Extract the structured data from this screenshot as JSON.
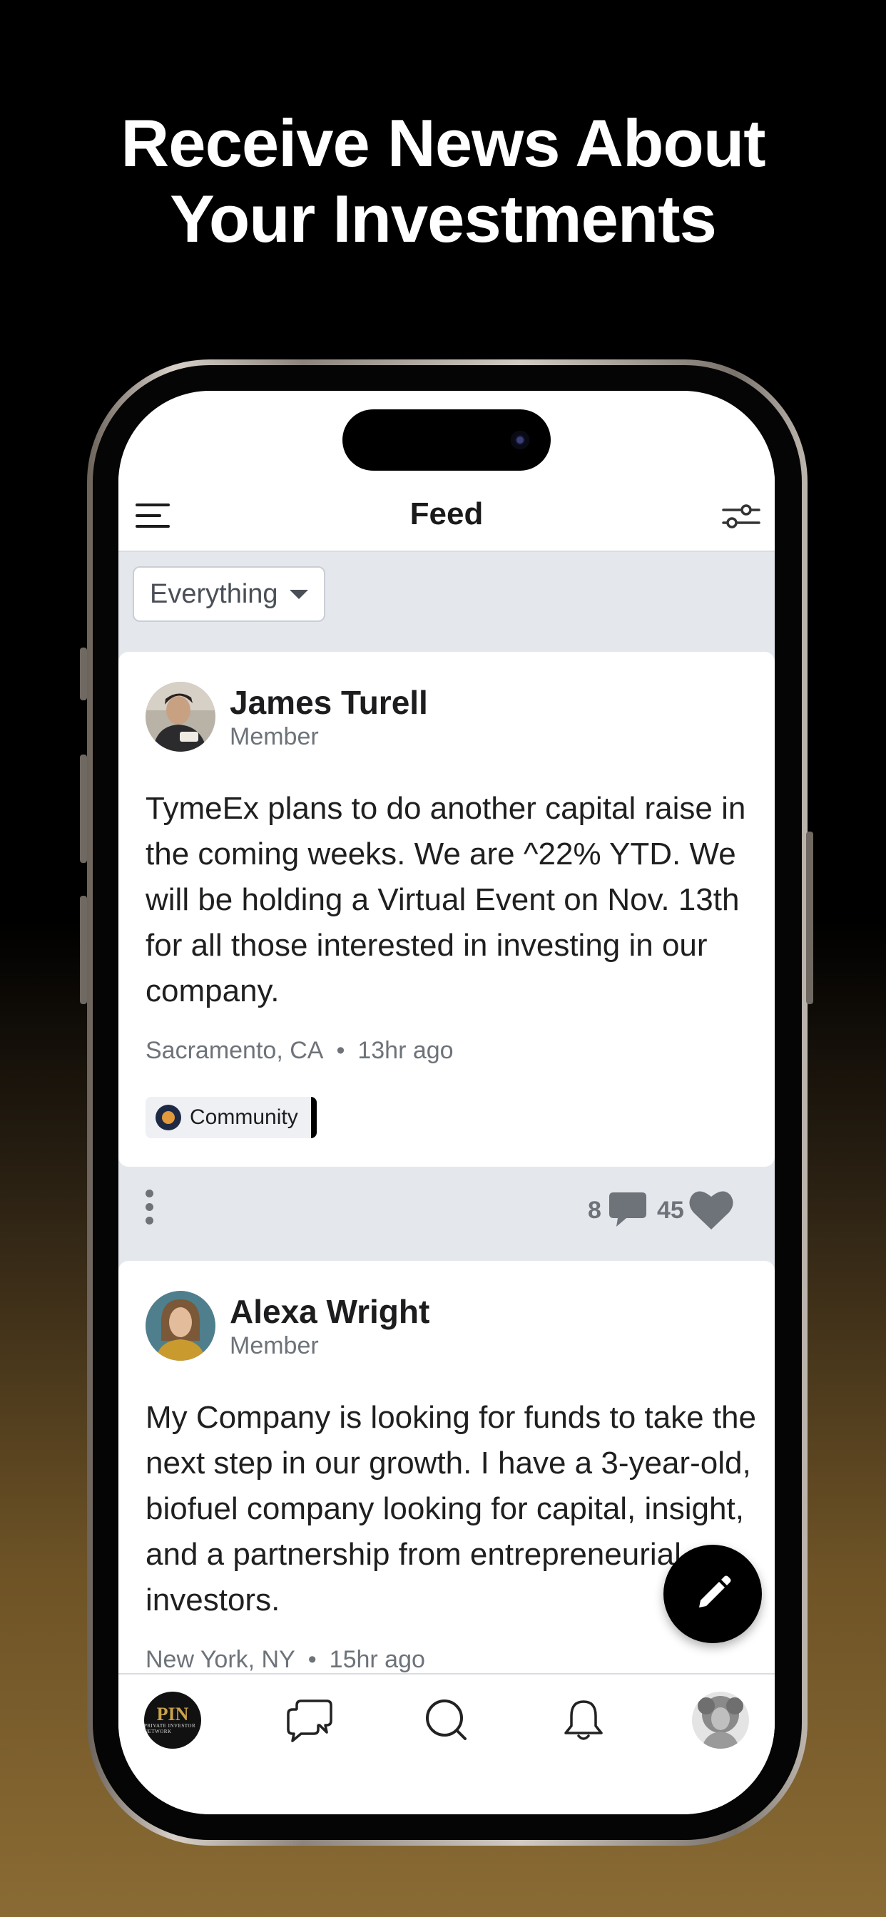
{
  "headline": {
    "line1": "Receive News About",
    "line2": "Your Investments"
  },
  "nav": {
    "title": "Feed",
    "menu_icon": "hamburger-icon",
    "filter_icon": "sliders-icon"
  },
  "filter": {
    "selected": "Everything"
  },
  "posts": [
    {
      "author": "James Turell",
      "role": "Member",
      "body": "TymeEx plans to do another capital raise in the coming weeks. We are ^22% YTD. We will be holding a Virtual Event on Nov. 13th for all those interested in investing in our company.",
      "location": "Sacramento, CA",
      "time": "13hr ago",
      "tag": "Community",
      "comments": "8",
      "likes": "45"
    },
    {
      "author": "Alexa Wright",
      "role": "Member",
      "body": "My Company is looking for funds to take the next step in our growth. I have a 3-year-old, biofuel company looking for capital, insight, and a partnership from entrepreneurial investors.",
      "location": "New York, NY",
      "time": "15hr ago"
    }
  ],
  "tabbar": {
    "logo_text": "PIN",
    "logo_subtext": "PRIVATE INVESTOR NETWORK",
    "items": [
      "home-logo",
      "messages-icon",
      "search-icon",
      "bell-icon",
      "profile-avatar"
    ]
  },
  "colors": {
    "accent": "#000000",
    "feed_bg": "#e4e7ec",
    "muted": "#6e737a",
    "gold": "#8a6b34"
  }
}
